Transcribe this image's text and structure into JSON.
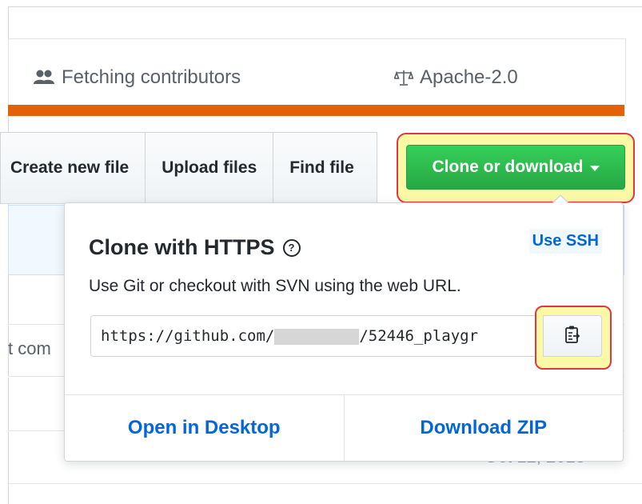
{
  "summary": {
    "contributors_label": "Fetching contributors",
    "license_label": "Apache-2.0",
    "language_bar_color": "#e36209"
  },
  "toolbar": {
    "create_file_label": "Create new file",
    "upload_files_label": "Upload files",
    "find_file_label": "Find file",
    "clone_label": "Clone or download",
    "clone_color": "#28a745"
  },
  "background": {
    "row_fragment": "t com",
    "date_fragment": "Oct 12, 2018"
  },
  "popover": {
    "title": "Clone with HTTPS",
    "help_glyph": "?",
    "use_ssh_label": "Use SSH",
    "description": "Use Git or checkout with SVN using the web URL.",
    "url_prefix": "https://github.com/",
    "url_suffix": "/52446_playgr",
    "open_desktop_label": "Open in Desktop",
    "download_zip_label": "Download ZIP",
    "copy_icon": "clipboard-icon"
  },
  "highlight_color": "#fbf9a6",
  "highlight_border_color": "#e0383e"
}
